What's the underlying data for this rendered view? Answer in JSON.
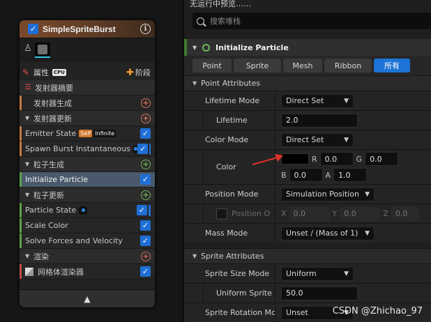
{
  "node": {
    "title": "SimpleSpriteBurst",
    "tab_attributes": "属性",
    "tab_cpu": "CPU",
    "tab_stage": "阶段",
    "rows": [
      {
        "label": "发射器摘要",
        "kind": "summary"
      },
      {
        "label": "发射器生成",
        "kind": "group-noarrow"
      },
      {
        "label": "发射器更新",
        "kind": "group"
      },
      {
        "label": "Emitter State",
        "kind": "module",
        "badge_self": "Self",
        "badge_inf": "Infinite"
      },
      {
        "label": "Spawn Burst Instantaneous",
        "kind": "module"
      },
      {
        "label": "粒子生成",
        "kind": "group"
      },
      {
        "label": "Initialize Particle",
        "kind": "module-selected"
      },
      {
        "label": "粒子更新",
        "kind": "group"
      },
      {
        "label": "Particle State",
        "kind": "module"
      },
      {
        "label": "Scale Color",
        "kind": "module"
      },
      {
        "label": "Solve Forces and Velocity",
        "kind": "module"
      },
      {
        "label": "渲染",
        "kind": "group"
      },
      {
        "label": "网格体渲染器",
        "kind": "module"
      }
    ]
  },
  "panel": {
    "top_status": "无运行中预览……",
    "search_placeholder": "搜索堆栈",
    "section_title": "Initialize Particle",
    "filters": [
      "Point",
      "Sprite",
      "Mesh",
      "Ribbon",
      "所有"
    ],
    "active_filter": "所有",
    "point_attributes": {
      "header": "Point Attributes",
      "lifetime_mode_label": "Lifetime Mode",
      "lifetime_mode_value": "Direct Set",
      "lifetime_label": "Lifetime",
      "lifetime_value": "2.0",
      "color_mode_label": "Color Mode",
      "color_mode_value": "Direct Set",
      "color_label": "Color",
      "color": {
        "R": "0.0",
        "G": "0.0",
        "B": "0.0",
        "A": "1.0"
      },
      "position_mode_label": "Position Mode",
      "position_mode_value": "Simulation Position",
      "position_offset_label": "Position Offset",
      "position_offset": {
        "X": "0.0",
        "Y": "0.0",
        "Z": "0.0"
      },
      "mass_mode_label": "Mass Mode",
      "mass_mode_value": "Unset / (Mass of 1)"
    },
    "sprite_attributes": {
      "header": "Sprite Attributes",
      "size_mode_label": "Sprite Size Mode",
      "size_mode_value": "Uniform",
      "uniform_size_label": "Uniform Sprite Size",
      "uniform_size_value": "50.0",
      "rotation_mode_label": "Sprite Rotation Mode",
      "rotation_mode_value": "Unset"
    }
  },
  "watermark": "CSDN @Zhichao_97",
  "colors": {
    "accent": "#1d74d6",
    "arrow": "#e0302a"
  }
}
